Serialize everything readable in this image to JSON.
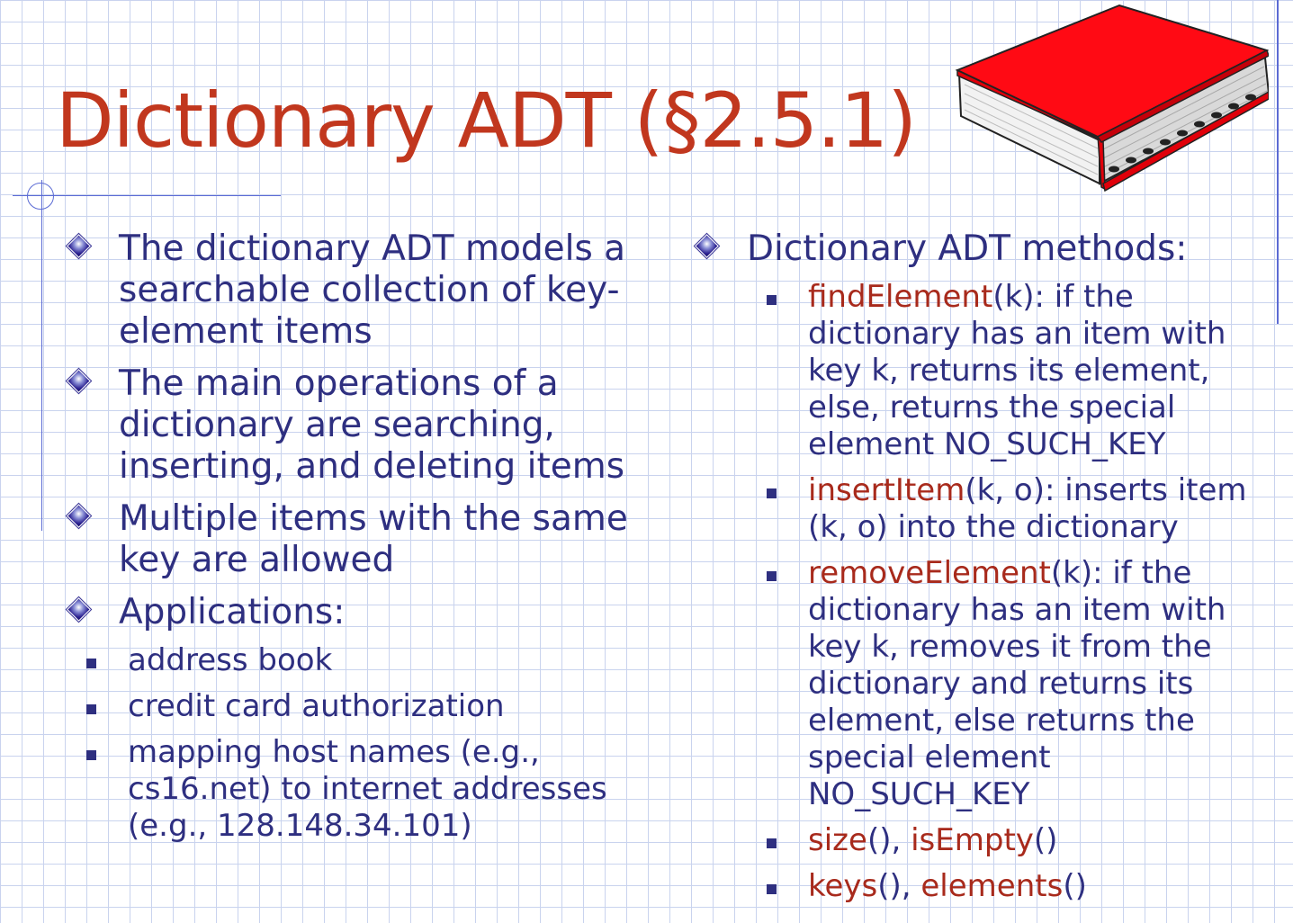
{
  "slide": {
    "title": "Dictionary ADT (§2.5.1)",
    "left_bullets": [
      "The dictionary ADT models a searchable collection of key-element items",
      "The main operations of a dictionary are searching, inserting, and deleting items",
      "Multiple items with the same key are allowed",
      "Applications:"
    ],
    "applications": [
      "address book",
      "credit card authorization",
      "mapping host names (e.g., cs16.net) to internet addresses (e.g., 128.148.34.101)"
    ],
    "right_heading": "Dictionary ADT methods:",
    "methods": [
      {
        "name": "findElement",
        "args": "(k)",
        "desc": ": if the dictionary has an item with key k, returns its element, else, returns the special element NO_SUCH_KEY"
      },
      {
        "name": "insertItem",
        "args": "(k, o)",
        "desc": ": inserts item (k, o) into the dictionary"
      },
      {
        "name": "removeElement",
        "args": "(k)",
        "desc": ": if the dictionary has an item with key k, removes it from the dictionary and returns its element, else returns the special element NO_SUCH_KEY"
      },
      {
        "name": "size",
        "args": "(), ",
        "name2": "isEmpty",
        "args2": "()"
      },
      {
        "name": "keys",
        "args": "(), ",
        "name2": "elements",
        "args2": "()"
      }
    ]
  },
  "colors": {
    "title": "#c1371e",
    "body_text": "#2e2f80",
    "method_name": "#a82a1c",
    "grid": "#c9d3ee",
    "accent_line": "#5b6bd4",
    "book_cover": "#ff0a14"
  },
  "icons": {
    "bullet_l1": "diamond-bullet-icon",
    "bullet_l2": "square-bullet-icon",
    "book": "book-icon"
  }
}
